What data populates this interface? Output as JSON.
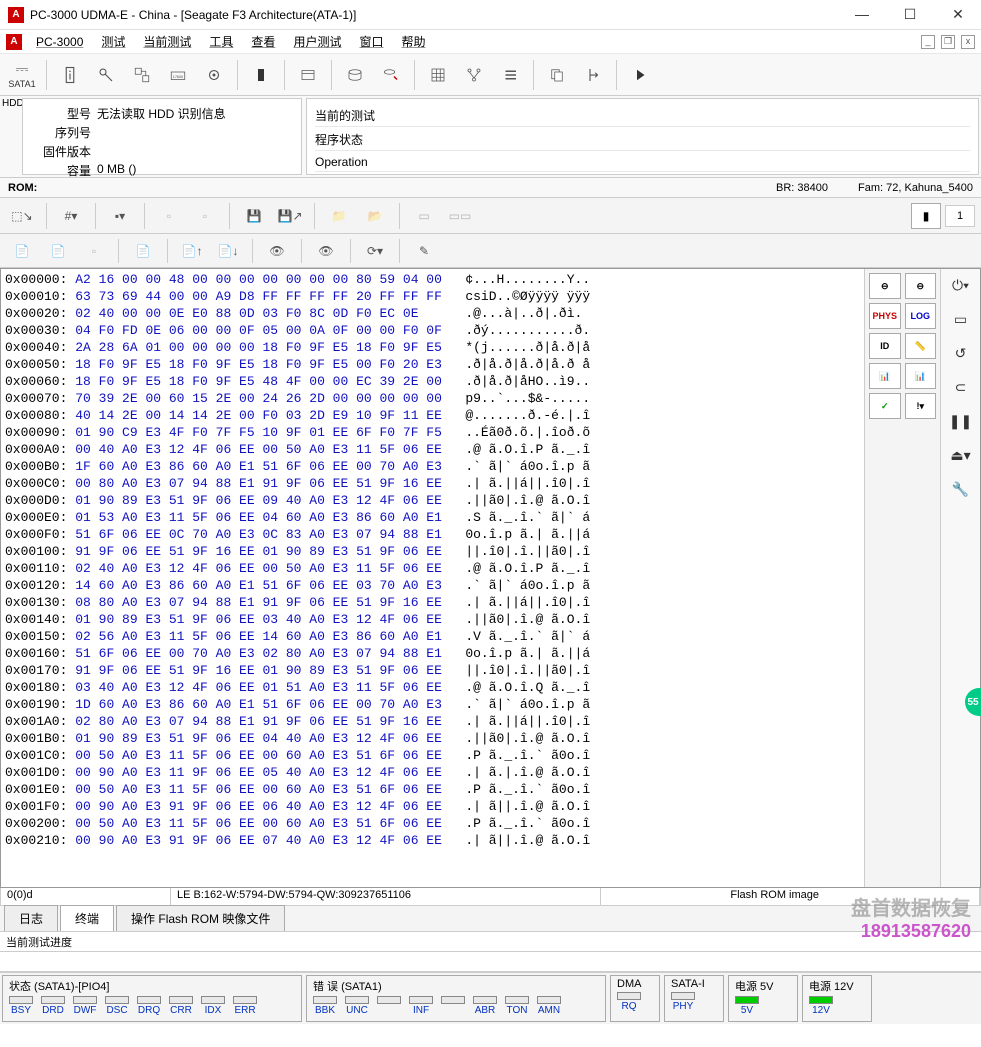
{
  "window": {
    "title": "PC-3000 UDMA-E - China - [Seagate F3 Architecture(ATA-1)]"
  },
  "menu": [
    "PC-3000",
    "测试",
    "当前测试",
    "工具",
    "查看",
    "用户测试",
    "窗口",
    "帮助"
  ],
  "hdd": {
    "tab": "HDD",
    "model_lbl": "型号",
    "model_val": "无法读取 HDD 识别信息",
    "serial_lbl": "序列号",
    "serial_val": "",
    "fw_lbl": "固件版本",
    "fw_val": "",
    "cap_lbl": "容量",
    "cap_val": "0 MB ()"
  },
  "current": {
    "test_lbl": "当前的测试",
    "test_val": "程序状态",
    "op_lbl": "Operation",
    "op_val": ""
  },
  "status": {
    "rom": "ROM:",
    "br": "BR: 38400",
    "fam": "Fam: 72, Kahuna_5400"
  },
  "toolstrip_right": {
    "chip_num": "1"
  },
  "side": {
    "phys": "PHYS",
    "log": "LOG"
  },
  "hexstatus": {
    "c1": "0(0)d",
    "c2": "LE B:162-W:5794-DW:5794-QW:309237651106",
    "c3": "Flash ROM image"
  },
  "tabs": [
    "日志",
    "终端",
    "操作 Flash ROM 映像文件"
  ],
  "progress_lbl": "当前测试进度",
  "bottom": {
    "state": {
      "title": "状态 (SATA1)-[PIO4]",
      "leds": [
        "BSY",
        "DRD",
        "DWF",
        "DSC",
        "DRQ",
        "CRR",
        "IDX",
        "ERR"
      ]
    },
    "error": {
      "title": "错 误 (SATA1)",
      "leds": [
        "BBK",
        "UNC",
        "",
        "INF",
        "",
        "ABR",
        "TON",
        "AMN"
      ]
    },
    "dma": {
      "title": "DMA",
      "led": "RQ"
    },
    "satai": {
      "title": "SATA-I",
      "led": "PHY"
    },
    "p5": {
      "title": "电源 5V",
      "led": "5V"
    },
    "p12": {
      "title": "电源 12V",
      "led": "12V"
    }
  },
  "watermark": {
    "w1": "盘首数据恢复",
    "w2": "18913587620"
  },
  "badge": "55",
  "hex": [
    {
      "o": "0x00000:",
      "h": "A2 16 00 00 48 00 00 00 00 00 00 00 80 59 04 00",
      "a": "¢...H........Y.."
    },
    {
      "o": "0x00010:",
      "h": "63 73 69 44 00 00 A9 D8 FF FF FF FF 20 FF FF FF",
      "a": "csiD..©Øÿÿÿÿ ÿÿÿ"
    },
    {
      "o": "0x00020:",
      "h": "02 40 00 00 0E E0 88 0D 03 F0 8C 0D F0 EC 0E",
      "a": ".@...à|..ð|.ðì."
    },
    {
      "o": "0x00030:",
      "h": "04 F0 FD 0E 06 00 00 0F 05 00 0A 0F 00 00 F0 0F",
      "a": ".ðý...........ð."
    },
    {
      "o": "0x00040:",
      "h": "2A 28 6A 01 00 00 00 00 18 F0 9F E5 18 F0 9F E5",
      "a": "*(j......ð|å.ð|å"
    },
    {
      "o": "0x00050:",
      "h": "18 F0 9F E5 18 F0 9F E5 18 F0 9F E5 00 F0 20 E3",
      "a": ".ð|å.ð|å.ð|å.ð å"
    },
    {
      "o": "0x00060:",
      "h": "18 F0 9F E5 18 F0 9F E5 48 4F 00 00 EC 39 2E 00",
      "a": ".ð|å.ð|åHO..ì9.."
    },
    {
      "o": "0x00070:",
      "h": "70 39 2E 00 60 15 2E 00 24 26 2D 00 00 00 00 00",
      "a": "p9..`...$&-....."
    },
    {
      "o": "0x00080:",
      "h": "40 14 2E 00 14 14 2E 00 F0 03 2D E9 10 9F 11 EE",
      "a": "@.......ð.-é.|.î"
    },
    {
      "o": "0x00090:",
      "h": "01 90 C9 E3 4F F0 7F F5 10 9F 01 EE 6F F0 7F F5",
      "a": "..Éã0ð.õ.|.îoð.õ"
    },
    {
      "o": "0x000A0:",
      "h": "00 40 A0 E3 12 4F 06 EE 00 50 A0 E3 11 5F 06 EE",
      "a": ".@ ã.O.î.P ã._.î"
    },
    {
      "o": "0x000B0:",
      "h": "1F 60 A0 E3 86 60 A0 E1 51 6F 06 EE 00 70 A0 E3",
      "a": ".` ã|` á0o.î.p ã"
    },
    {
      "o": "0x000C0:",
      "h": "00 80 A0 E3 07 94 88 E1 91 9F 06 EE 51 9F 16 EE",
      "a": ".| ã.||á||.î0|.î"
    },
    {
      "o": "0x000D0:",
      "h": "01 90 89 E3 51 9F 06 EE 09 40 A0 E3 12 4F 06 EE",
      "a": ".||ã0|.î.@ ã.O.î"
    },
    {
      "o": "0x000E0:",
      "h": "01 53 A0 E3 11 5F 06 EE 04 60 A0 E3 86 60 A0 E1",
      "a": ".S ã._.î.` ã|` á"
    },
    {
      "o": "0x000F0:",
      "h": "51 6F 06 EE 0C 70 A0 E3 0C 83 A0 E3 07 94 88 E1",
      "a": "0o.î.p ã.| ã.||á"
    },
    {
      "o": "0x00100:",
      "h": "91 9F 06 EE 51 9F 16 EE 01 90 89 E3 51 9F 06 EE",
      "a": "||.î0|.î.||ã0|.î"
    },
    {
      "o": "0x00110:",
      "h": "02 40 A0 E3 12 4F 06 EE 00 50 A0 E3 11 5F 06 EE",
      "a": ".@ ã.O.î.P ã._.î"
    },
    {
      "o": "0x00120:",
      "h": "14 60 A0 E3 86 60 A0 E1 51 6F 06 EE 03 70 A0 E3",
      "a": ".` ã|` á0o.î.p ã"
    },
    {
      "o": "0x00130:",
      "h": "08 80 A0 E3 07 94 88 E1 91 9F 06 EE 51 9F 16 EE",
      "a": ".| ã.||á||.î0|.î"
    },
    {
      "o": "0x00140:",
      "h": "01 90 89 E3 51 9F 06 EE 03 40 A0 E3 12 4F 06 EE",
      "a": ".||ã0|.î.@ ã.O.î"
    },
    {
      "o": "0x00150:",
      "h": "02 56 A0 E3 11 5F 06 EE 14 60 A0 E3 86 60 A0 E1",
      "a": ".V ã._.î.` ã|` á"
    },
    {
      "o": "0x00160:",
      "h": "51 6F 06 EE 00 70 A0 E3 02 80 A0 E3 07 94 88 E1",
      "a": "0o.î.p ã.| ã.||á"
    },
    {
      "o": "0x00170:",
      "h": "91 9F 06 EE 51 9F 16 EE 01 90 89 E3 51 9F 06 EE",
      "a": "||.î0|.î.||ã0|.î"
    },
    {
      "o": "0x00180:",
      "h": "03 40 A0 E3 12 4F 06 EE 01 51 A0 E3 11 5F 06 EE",
      "a": ".@ ã.O.î.Q ã._.î"
    },
    {
      "o": "0x00190:",
      "h": "1D 60 A0 E3 86 60 A0 E1 51 6F 06 EE 00 70 A0 E3",
      "a": ".` ã|` á0o.î.p ã"
    },
    {
      "o": "0x001A0:",
      "h": "02 80 A0 E3 07 94 88 E1 91 9F 06 EE 51 9F 16 EE",
      "a": ".| ã.||á||.î0|.î"
    },
    {
      "o": "0x001B0:",
      "h": "01 90 89 E3 51 9F 06 EE 04 40 A0 E3 12 4F 06 EE",
      "a": ".||ã0|.î.@ ã.O.î"
    },
    {
      "o": "0x001C0:",
      "h": "00 50 A0 E3 11 5F 06 EE 00 60 A0 E3 51 6F 06 EE",
      "a": ".P ã._.î.` ã0o.î"
    },
    {
      "o": "0x001D0:",
      "h": "00 90 A0 E3 11 9F 06 EE 05 40 A0 E3 12 4F 06 EE",
      "a": ".| ã.|.î.@ ã.O.î"
    },
    {
      "o": "0x001E0:",
      "h": "00 50 A0 E3 11 5F 06 EE 00 60 A0 E3 51 6F 06 EE",
      "a": ".P ã._.î.` ã0o.î"
    },
    {
      "o": "0x001F0:",
      "h": "00 90 A0 E3 91 9F 06 EE 06 40 A0 E3 12 4F 06 EE",
      "a": ".| ã||.î.@ ã.O.î"
    },
    {
      "o": "0x00200:",
      "h": "00 50 A0 E3 11 5F 06 EE 00 60 A0 E3 51 6F 06 EE",
      "a": ".P ã._.î.` ã0o.î"
    },
    {
      "o": "0x00210:",
      "h": "00 90 A0 E3 91 9F 06 EE 07 40 A0 E3 12 4F 06 EE",
      "a": ".| ã||.î.@ ã.O.î"
    }
  ]
}
